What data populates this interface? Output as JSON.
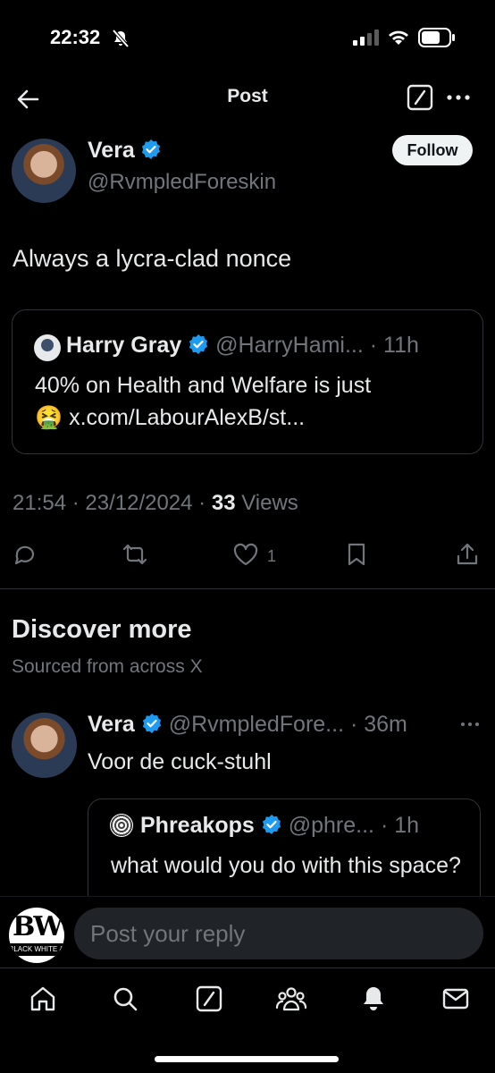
{
  "status_bar": {
    "time": "22:32"
  },
  "nav": {
    "title": "Post"
  },
  "post": {
    "author_name": "Vera",
    "author_handle": "@RvmpledForeskin",
    "follow_label": "Follow",
    "text": "Always a lycra-clad nonce",
    "quote": {
      "name": "Harry Gray",
      "handle_time": "@HarryHami... · 11h",
      "line1": "40% on Health and Welfare is just",
      "emoji": "🤮",
      "line2": "x.com/LabourAlexB/st..."
    },
    "timestamp": "21:54 · 23/12/2024 · ",
    "views_count": "33",
    "views_label": " Views",
    "like_count": "1"
  },
  "discover": {
    "title": "Discover more",
    "subtitle": "Sourced from across X"
  },
  "recommended_post": {
    "author_name": "Vera",
    "handle_time": "@RvmpledFore... · 36m",
    "text": "Voor de cuck-stuhl",
    "quote": {
      "name": "Phreakops",
      "handle_time": "@phre... · 1h",
      "body": "what would you do with this space?"
    }
  },
  "reply": {
    "placeholder": "Post your reply",
    "avatar_logo_letters": "BWG",
    "avatar_logo_sub": "BLACK WHITE & GREY"
  },
  "icons": {
    "back": "arrow-left-icon",
    "grok": "grok-icon",
    "more": "more-horizontal-icon",
    "verified": "verified-badge-icon",
    "reply": "comment-icon",
    "repost": "repost-icon",
    "like": "heart-icon",
    "bookmark": "bookmark-icon",
    "share": "share-icon",
    "tabs": [
      "home-icon",
      "search-icon",
      "grok-icon",
      "communities-icon",
      "notifications-icon",
      "messages-icon"
    ]
  },
  "colors": {
    "verified": "#1d9bf0",
    "muted": "#71767b",
    "text": "#e7e9ea",
    "border": "#2f3336"
  }
}
